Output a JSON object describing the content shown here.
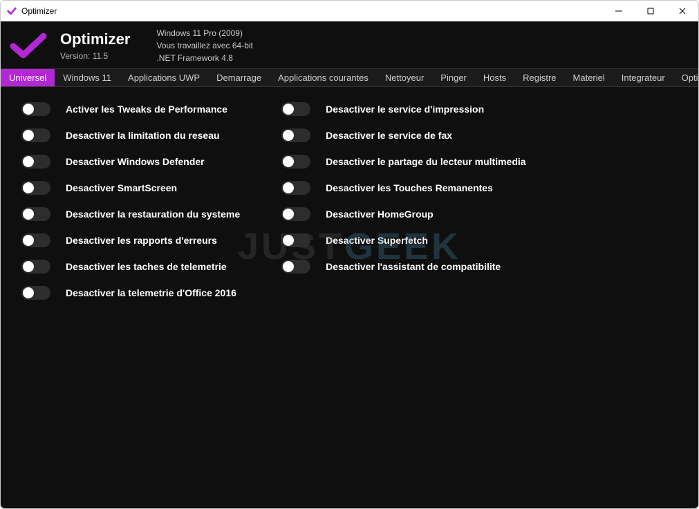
{
  "titlebar": {
    "title": "Optimizer"
  },
  "header": {
    "app_name": "Optimizer",
    "version_label": "Version: 11.5",
    "sysinfo": {
      "line1": "Windows 11 Pro (2009)",
      "line2": "Vous travaillez avec 64-bit",
      "line3": ".NET Framework 4.8"
    }
  },
  "tabs": [
    "Universel",
    "Windows 11",
    "Applications UWP",
    "Demarrage",
    "Applications courantes",
    "Nettoyeur",
    "Pinger",
    "Hosts",
    "Registre",
    "Materiel",
    "Integrateur",
    "Options"
  ],
  "active_tab_index": 0,
  "toggles": {
    "left": [
      "Activer les Tweaks de Performance",
      "Desactiver la limitation du reseau",
      "Desactiver Windows Defender",
      "Desactiver SmartScreen",
      "Desactiver la restauration du systeme",
      "Desactiver les rapports d'erreurs",
      "Desactiver les taches de telemetrie",
      "Desactiver la telemetrie d'Office 2016"
    ],
    "right": [
      "Desactiver le service d'impression",
      "Desactiver le service de fax",
      "Desactiver le partage du lecteur multimedia",
      "Desactiver les Touches Remanentes",
      "Desactiver HomeGroup",
      "Desactiver Superfetch",
      "Desactiver l'assistant de compatibilite"
    ]
  },
  "watermark": {
    "part1": "JUST",
    "part2": "GEEK"
  },
  "accent_color": "#b327d5"
}
